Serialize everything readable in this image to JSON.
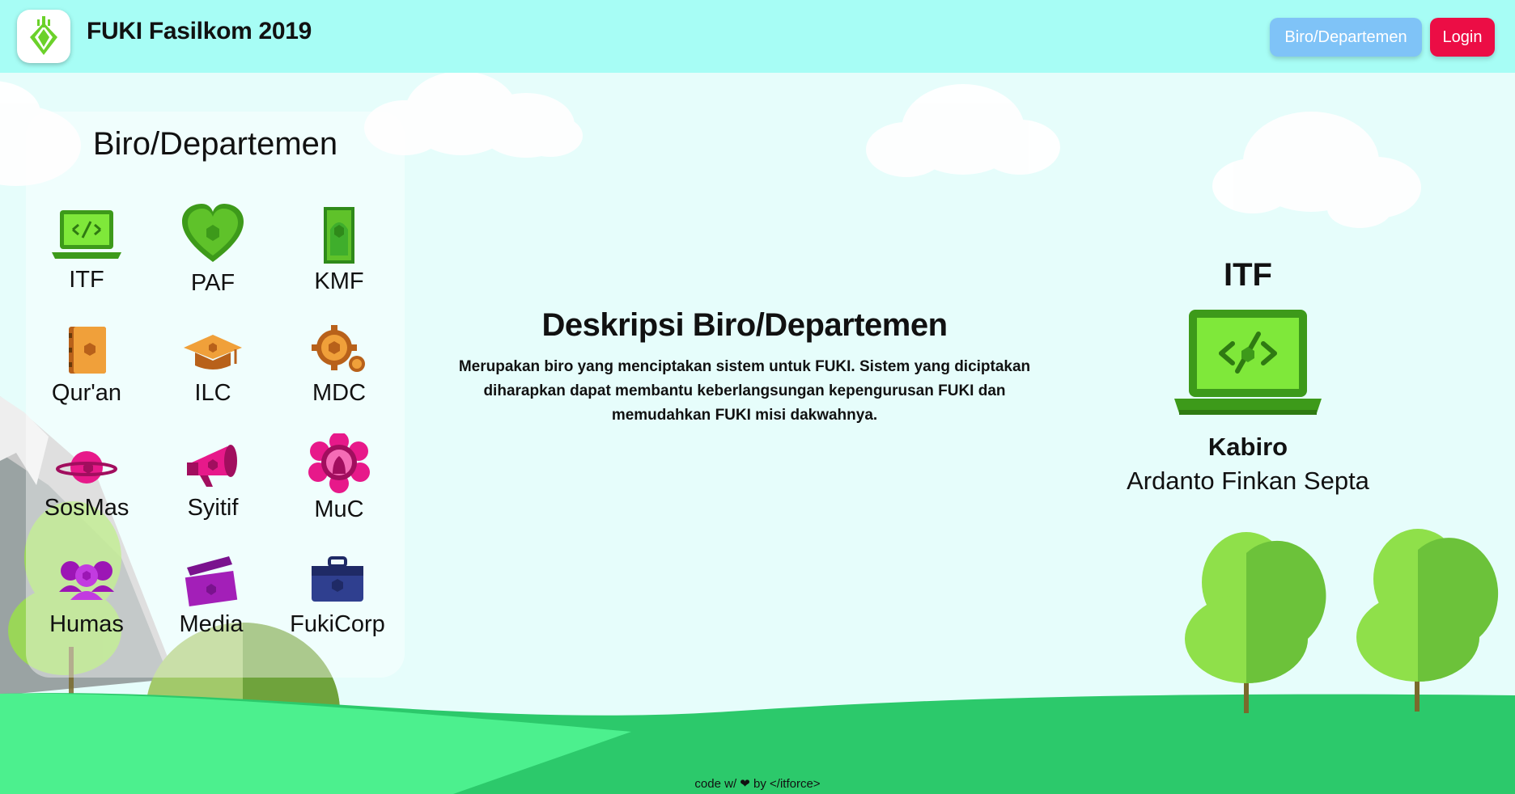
{
  "header": {
    "brand": "FUKI Fasilkom 2019",
    "nav_biro_label": "Biro/Departemen",
    "login_label": "Login"
  },
  "sidebar": {
    "title": "Biro/Departemen",
    "items": [
      {
        "label": "ITF",
        "icon": "laptop-code-icon",
        "color": "#5fdc2a"
      },
      {
        "label": "PAF",
        "icon": "heart-icon",
        "color": "#4ab81b"
      },
      {
        "label": "KMF",
        "icon": "prayer-mat-icon",
        "color": "#3fae2c"
      },
      {
        "label": "Qur'an",
        "icon": "book-icon",
        "color": "#e68a24"
      },
      {
        "label": "ILC",
        "icon": "graduation-cap-icon",
        "color": "#e68a24"
      },
      {
        "label": "MDC",
        "icon": "gears-icon",
        "color": "#e68a24"
      },
      {
        "label": "SosMas",
        "icon": "planet-icon",
        "color": "#e7198a"
      },
      {
        "label": "Syitif",
        "icon": "megaphone-icon",
        "color": "#e7198a"
      },
      {
        "label": "MuC",
        "icon": "flower-woman-icon",
        "color": "#e7198a"
      },
      {
        "label": "Humas",
        "icon": "people-icon",
        "color": "#9c16b5"
      },
      {
        "label": "Media",
        "icon": "clapperboard-icon",
        "color": "#a31fb8"
      },
      {
        "label": "FukiCorp",
        "icon": "briefcase-icon",
        "color": "#2f3f8f"
      }
    ]
  },
  "main": {
    "desc_title": "Deskripsi Biro/Departemen",
    "desc_text": "Merupakan biro yang menciptakan sistem untuk FUKI. Sistem yang diciptakan diharapkan dapat membantu keberlangsungan kepengurusan FUKI dan memudahkan FUKI misi dakwahnya."
  },
  "detail": {
    "code": "ITF",
    "role": "Kabiro",
    "name": "Ardanto Finkan Septa",
    "icon": "laptop-code-icon"
  },
  "footer": {
    "text": "code w/ ❤ by </itforce>"
  },
  "colors": {
    "navbar": "#a7fdf5",
    "biro_button": "#7fc3f7",
    "login_button": "#ec0d45",
    "grass": "#2cc96b"
  }
}
